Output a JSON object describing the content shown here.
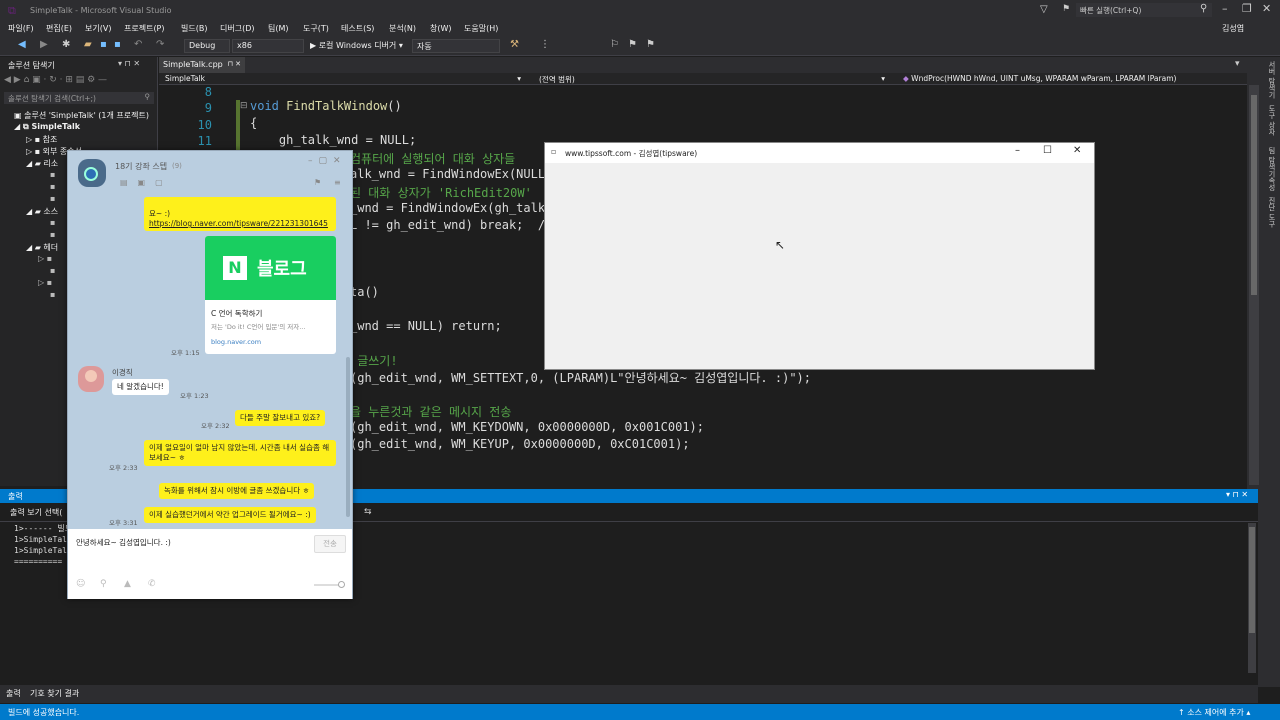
{
  "titlebar": {
    "title": "SimpleTalk - Microsoft Visual Studio",
    "quick_launch": "빠른 실행(Ctrl+Q)",
    "user": "김성엽"
  },
  "menu": [
    "파일(F)",
    "편집(E)",
    "보기(V)",
    "프로젝트(P)",
    "빌드(B)",
    "디버그(D)",
    "팀(M)",
    "도구(T)",
    "테스트(S)",
    "분석(N)",
    "창(W)",
    "도움말(H)"
  ],
  "toolbar": {
    "config": "Debug",
    "platform": "x86",
    "run": "▶ 로컬 Windows 디버거 ▾",
    "mode": "자동"
  },
  "solution_explorer": {
    "title": "솔루션 탐색기",
    "search": "솔루션 탐색기 검색(Ctrl+;)",
    "root": "솔루션 'SimpleTalk' (1개 프로젝트)",
    "project": "SimpleTalk",
    "items": [
      "참조",
      "외부 종속성",
      "리소",
      "소스",
      "헤더"
    ]
  },
  "editor": {
    "tabs": [
      "SimpleTalk.cpp"
    ],
    "nav": {
      "project": "SimpleTalk",
      "scope": "(전역 범위)",
      "func": "WndProc(HWND hWnd, UINT uMsg, WPARAM wParam, LPARAM lParam)"
    },
    "line_numbers": [
      "8",
      "9",
      "10",
      "11"
    ],
    "lines": [
      {
        "plain": "void ",
        "fn": "FindTalkWindow",
        "rest": "()"
      },
      {
        "plain": "{"
      },
      {
        "plain": "    gh_talk_wnd = NULL;"
      },
      {
        "plain": "컴퓨터에 실행되어 대화 상자들"
      },
      {
        "plain": "alk_wnd = FindWindowEx(NULL,"
      },
      {
        "plain": "된 대화 상자가 'RichEdit20W'"
      },
      {
        "plain": "_wnd = FindWindowEx(gh_talk_"
      },
      {
        "plain": "L != gh_edit_wnd) break;  //"
      },
      {
        "plain": "ta()"
      },
      {
        "plain": "_wnd == NULL) return;"
      },
      {
        "plain": " 글쓰기!"
      },
      {
        "plain": "(gh_edit_wnd, WM_SETTEXT,0, (LPARAM)L\"안녕하세요~ 김성엽입니다. :)\");"
      },
      {
        "plain": "을 누른것과 같은 메시지 전송"
      },
      {
        "plain": "(gh_edit_wnd, WM_KEYDOWN, 0x0000000D, 0x001C001);"
      },
      {
        "plain": "(gh_edit_wnd, WM_KEYUP, 0x0000000D, 0xC01C001);"
      }
    ]
  },
  "output": {
    "title": "출력",
    "source_label": "출력 보기 선택(",
    "lines": [
      "1>------ 빌드",
      "1>SimpleTalk.",
      "1>SimpleTalk.",
      "========== 빌"
    ]
  },
  "bottom_tabs": [
    "출력",
    "기호 찾기 결과"
  ],
  "statusbar": {
    "left": "빌드에 성공했습니다.",
    "right": "↑ 소스 제어에 추가 ▴"
  },
  "right_strip": [
    "서버 탐색기",
    "도구 상자",
    "팀 탐색기",
    "속성",
    "진단 도구"
  ],
  "talk": {
    "title": "18기 강좌 스텝",
    "count": "(9)",
    "link": "https://blog.naver.com/tipsware/221231301645",
    "link_prefix": "요~ :)",
    "card_logo": "블로그",
    "card_title": "C 언어 독학하기",
    "card_desc": "저는 'Do it! C언어 입문'의 저자...",
    "card_url": "blog.naver.com",
    "t1": "오후 1:15",
    "sender": "이경직",
    "msg_w": "네 알겠습니다!",
    "t2": "오후 1:23",
    "m1": "다들 주말 잘보내고 있죠?",
    "t3": "오후 2:32",
    "m2": "이제 얼요일이 얼마 남지 않았는데, 시간좀 내서 실습좀 해보세요~ ㅎ",
    "t4": "오후 2:33",
    "m3": "녹화를 위해서 잠시 이방에 글좀 쓰겠습니다 ㅎ",
    "m4": "이제 실습했던거에서 약간 업그레이드 될거에요~ :)",
    "t5": "오후 3:31",
    "input": "안녕하세요~ 김성엽입니다. :)",
    "send": "전송"
  },
  "popup": {
    "title": "www.tipssoft.com - 김성엽(tipsware)"
  }
}
